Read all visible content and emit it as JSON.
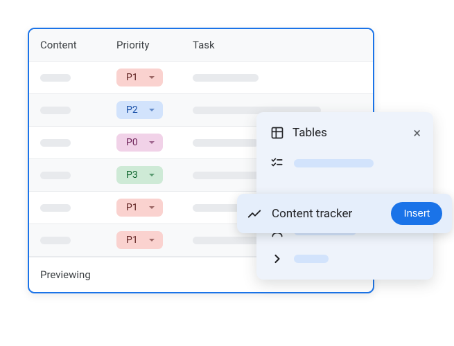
{
  "table": {
    "columns": [
      "Content",
      "Priority",
      "Task"
    ],
    "rows": [
      {
        "priority_label": "P1",
        "priority_class": "p1"
      },
      {
        "priority_label": "P2",
        "priority_class": "p2"
      },
      {
        "priority_label": "P0",
        "priority_class": "p0"
      },
      {
        "priority_label": "P3",
        "priority_class": "p3"
      },
      {
        "priority_label": "P1",
        "priority_class": "p1"
      },
      {
        "priority_label": "P1",
        "priority_class": "p1"
      }
    ],
    "footer_label": "Previewing"
  },
  "popover": {
    "title": "Tables",
    "highlighted_label": "Content tracker",
    "insert_label": "Insert"
  }
}
